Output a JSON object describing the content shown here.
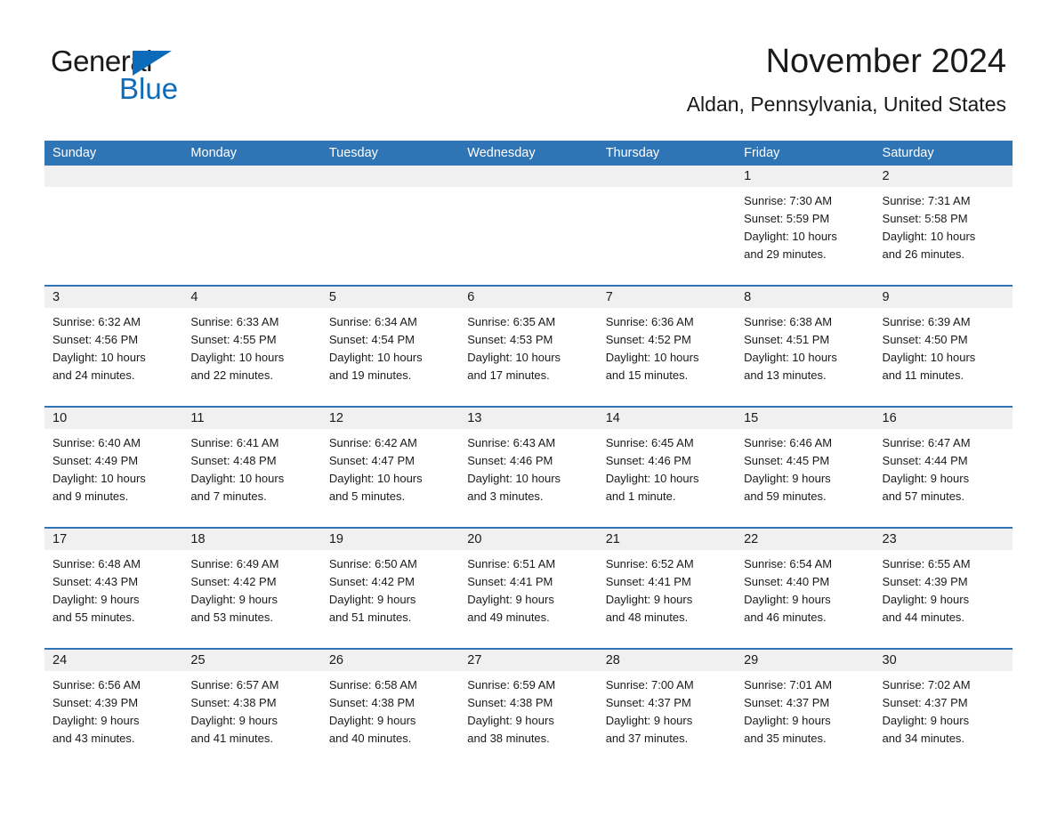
{
  "brand": {
    "name_part1": "General",
    "name_part2": "Blue",
    "accent_color": "#0d6cb9"
  },
  "header": {
    "title": "November 2024",
    "subtitle": "Aldan, Pennsylvania, United States",
    "header_bar_color": "#2f74b5",
    "datenum_strip_color": "#f0f0f0"
  },
  "weekdays": [
    {
      "label": "Sunday"
    },
    {
      "label": "Monday"
    },
    {
      "label": "Tuesday"
    },
    {
      "label": "Wednesday"
    },
    {
      "label": "Thursday"
    },
    {
      "label": "Friday"
    },
    {
      "label": "Saturday"
    }
  ],
  "weeks": [
    [
      {
        "day": ""
      },
      {
        "day": ""
      },
      {
        "day": ""
      },
      {
        "day": ""
      },
      {
        "day": ""
      },
      {
        "day": "1",
        "sunrise": "Sunrise: 7:30 AM",
        "sunset": "Sunset: 5:59 PM",
        "daylight1": "Daylight: 10 hours",
        "daylight2": "and 29 minutes."
      },
      {
        "day": "2",
        "sunrise": "Sunrise: 7:31 AM",
        "sunset": "Sunset: 5:58 PM",
        "daylight1": "Daylight: 10 hours",
        "daylight2": "and 26 minutes."
      }
    ],
    [
      {
        "day": "3",
        "sunrise": "Sunrise: 6:32 AM",
        "sunset": "Sunset: 4:56 PM",
        "daylight1": "Daylight: 10 hours",
        "daylight2": "and 24 minutes."
      },
      {
        "day": "4",
        "sunrise": "Sunrise: 6:33 AM",
        "sunset": "Sunset: 4:55 PM",
        "daylight1": "Daylight: 10 hours",
        "daylight2": "and 22 minutes."
      },
      {
        "day": "5",
        "sunrise": "Sunrise: 6:34 AM",
        "sunset": "Sunset: 4:54 PM",
        "daylight1": "Daylight: 10 hours",
        "daylight2": "and 19 minutes."
      },
      {
        "day": "6",
        "sunrise": "Sunrise: 6:35 AM",
        "sunset": "Sunset: 4:53 PM",
        "daylight1": "Daylight: 10 hours",
        "daylight2": "and 17 minutes."
      },
      {
        "day": "7",
        "sunrise": "Sunrise: 6:36 AM",
        "sunset": "Sunset: 4:52 PM",
        "daylight1": "Daylight: 10 hours",
        "daylight2": "and 15 minutes."
      },
      {
        "day": "8",
        "sunrise": "Sunrise: 6:38 AM",
        "sunset": "Sunset: 4:51 PM",
        "daylight1": "Daylight: 10 hours",
        "daylight2": "and 13 minutes."
      },
      {
        "day": "9",
        "sunrise": "Sunrise: 6:39 AM",
        "sunset": "Sunset: 4:50 PM",
        "daylight1": "Daylight: 10 hours",
        "daylight2": "and 11 minutes."
      }
    ],
    [
      {
        "day": "10",
        "sunrise": "Sunrise: 6:40 AM",
        "sunset": "Sunset: 4:49 PM",
        "daylight1": "Daylight: 10 hours",
        "daylight2": "and 9 minutes."
      },
      {
        "day": "11",
        "sunrise": "Sunrise: 6:41 AM",
        "sunset": "Sunset: 4:48 PM",
        "daylight1": "Daylight: 10 hours",
        "daylight2": "and 7 minutes."
      },
      {
        "day": "12",
        "sunrise": "Sunrise: 6:42 AM",
        "sunset": "Sunset: 4:47 PM",
        "daylight1": "Daylight: 10 hours",
        "daylight2": "and 5 minutes."
      },
      {
        "day": "13",
        "sunrise": "Sunrise: 6:43 AM",
        "sunset": "Sunset: 4:46 PM",
        "daylight1": "Daylight: 10 hours",
        "daylight2": "and 3 minutes."
      },
      {
        "day": "14",
        "sunrise": "Sunrise: 6:45 AM",
        "sunset": "Sunset: 4:46 PM",
        "daylight1": "Daylight: 10 hours",
        "daylight2": "and 1 minute."
      },
      {
        "day": "15",
        "sunrise": "Sunrise: 6:46 AM",
        "sunset": "Sunset: 4:45 PM",
        "daylight1": "Daylight: 9 hours",
        "daylight2": "and 59 minutes."
      },
      {
        "day": "16",
        "sunrise": "Sunrise: 6:47 AM",
        "sunset": "Sunset: 4:44 PM",
        "daylight1": "Daylight: 9 hours",
        "daylight2": "and 57 minutes."
      }
    ],
    [
      {
        "day": "17",
        "sunrise": "Sunrise: 6:48 AM",
        "sunset": "Sunset: 4:43 PM",
        "daylight1": "Daylight: 9 hours",
        "daylight2": "and 55 minutes."
      },
      {
        "day": "18",
        "sunrise": "Sunrise: 6:49 AM",
        "sunset": "Sunset: 4:42 PM",
        "daylight1": "Daylight: 9 hours",
        "daylight2": "and 53 minutes."
      },
      {
        "day": "19",
        "sunrise": "Sunrise: 6:50 AM",
        "sunset": "Sunset: 4:42 PM",
        "daylight1": "Daylight: 9 hours",
        "daylight2": "and 51 minutes."
      },
      {
        "day": "20",
        "sunrise": "Sunrise: 6:51 AM",
        "sunset": "Sunset: 4:41 PM",
        "daylight1": "Daylight: 9 hours",
        "daylight2": "and 49 minutes."
      },
      {
        "day": "21",
        "sunrise": "Sunrise: 6:52 AM",
        "sunset": "Sunset: 4:41 PM",
        "daylight1": "Daylight: 9 hours",
        "daylight2": "and 48 minutes."
      },
      {
        "day": "22",
        "sunrise": "Sunrise: 6:54 AM",
        "sunset": "Sunset: 4:40 PM",
        "daylight1": "Daylight: 9 hours",
        "daylight2": "and 46 minutes."
      },
      {
        "day": "23",
        "sunrise": "Sunrise: 6:55 AM",
        "sunset": "Sunset: 4:39 PM",
        "daylight1": "Daylight: 9 hours",
        "daylight2": "and 44 minutes."
      }
    ],
    [
      {
        "day": "24",
        "sunrise": "Sunrise: 6:56 AM",
        "sunset": "Sunset: 4:39 PM",
        "daylight1": "Daylight: 9 hours",
        "daylight2": "and 43 minutes."
      },
      {
        "day": "25",
        "sunrise": "Sunrise: 6:57 AM",
        "sunset": "Sunset: 4:38 PM",
        "daylight1": "Daylight: 9 hours",
        "daylight2": "and 41 minutes."
      },
      {
        "day": "26",
        "sunrise": "Sunrise: 6:58 AM",
        "sunset": "Sunset: 4:38 PM",
        "daylight1": "Daylight: 9 hours",
        "daylight2": "and 40 minutes."
      },
      {
        "day": "27",
        "sunrise": "Sunrise: 6:59 AM",
        "sunset": "Sunset: 4:38 PM",
        "daylight1": "Daylight: 9 hours",
        "daylight2": "and 38 minutes."
      },
      {
        "day": "28",
        "sunrise": "Sunrise: 7:00 AM",
        "sunset": "Sunset: 4:37 PM",
        "daylight1": "Daylight: 9 hours",
        "daylight2": "and 37 minutes."
      },
      {
        "day": "29",
        "sunrise": "Sunrise: 7:01 AM",
        "sunset": "Sunset: 4:37 PM",
        "daylight1": "Daylight: 9 hours",
        "daylight2": "and 35 minutes."
      },
      {
        "day": "30",
        "sunrise": "Sunrise: 7:02 AM",
        "sunset": "Sunset: 4:37 PM",
        "daylight1": "Daylight: 9 hours",
        "daylight2": "and 34 minutes."
      }
    ]
  ]
}
